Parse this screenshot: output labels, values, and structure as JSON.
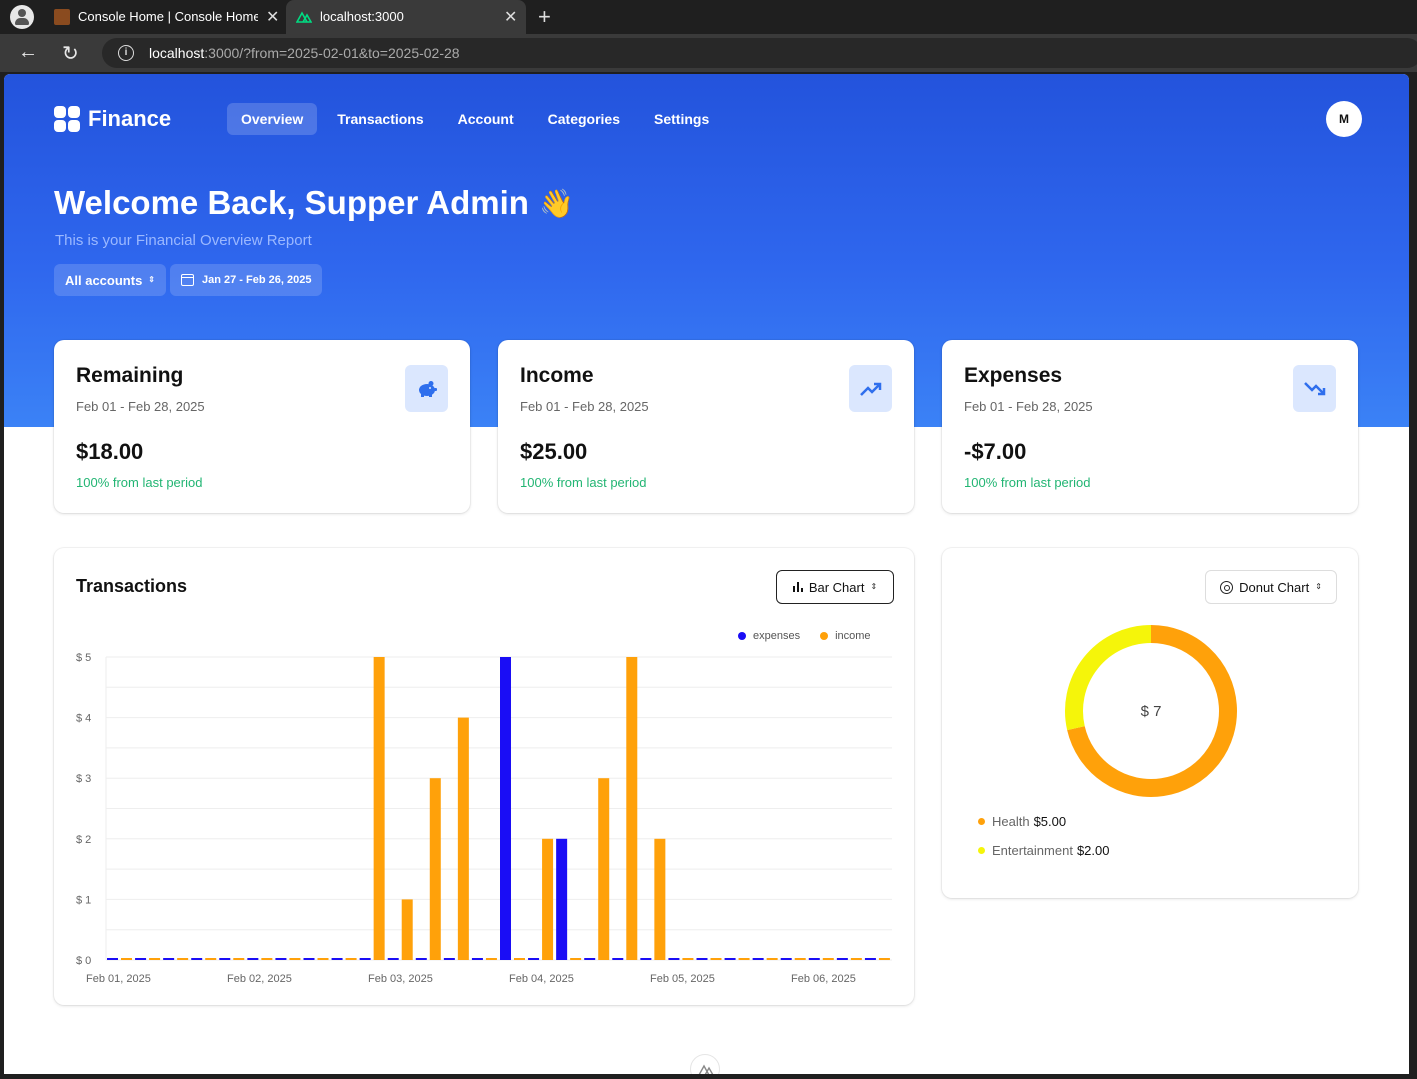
{
  "browser": {
    "tabs": [
      {
        "title": "Console Home | Console Home | c"
      },
      {
        "title": "localhost:3000"
      }
    ],
    "url_host": "localhost",
    "url_rest": ":3000/?from=2025-02-01&to=2025-02-28"
  },
  "header": {
    "logo": "Finance",
    "nav": [
      "Overview",
      "Transactions",
      "Account",
      "Categories",
      "Settings"
    ],
    "avatar": "M"
  },
  "hero": {
    "welcome": "Welcome Back, Supper Admin",
    "wave": "👋",
    "subtitle": "This is your Financial Overview Report",
    "account_filter": "All accounts",
    "date_filter": "Jan 27 - Feb 26, 2025"
  },
  "stats": [
    {
      "label": "Remaining",
      "period": "Feb 01 - Feb 28, 2025",
      "amount": "$18.00",
      "change": "100% from last period",
      "icon": "piggy-bank-icon"
    },
    {
      "label": "Income",
      "period": "Feb 01 - Feb 28, 2025",
      "amount": "$25.00",
      "change": "100% from last period",
      "icon": "trending-up-icon"
    },
    {
      "label": "Expenses",
      "period": "Feb 01 - Feb 28, 2025",
      "amount": "-$7.00",
      "change": "100% from last period",
      "icon": "trending-down-icon"
    }
  ],
  "colors": {
    "accent": "#2f67ee",
    "expenses": "#1a0df5",
    "income": "#ffa10a",
    "entertainment": "#f5f50a",
    "positive": "#22b573"
  },
  "transactions": {
    "title": "Transactions",
    "chart_select": "Bar Chart"
  },
  "donut": {
    "chart_select": "Donut Chart",
    "center": "$ 7",
    "items": [
      {
        "name": "Health",
        "value": "$5.00"
      },
      {
        "name": "Entertainment",
        "value": "$2.00"
      }
    ]
  },
  "chart_data": [
    {
      "type": "bar",
      "title": "Transactions",
      "series": [
        {
          "name": "expenses",
          "values": [
            0,
            0,
            0,
            0,
            0,
            0,
            0,
            0,
            0,
            0,
            0,
            0,
            0,
            0,
            5,
            0,
            2,
            0,
            0,
            0,
            0,
            0,
            0,
            0,
            0,
            0,
            0,
            0
          ]
        },
        {
          "name": "income",
          "values": [
            0,
            0,
            0,
            0,
            0,
            0,
            0,
            0,
            0,
            5,
            1,
            3,
            4,
            0,
            0,
            2,
            0,
            3,
            5,
            2,
            0,
            0,
            0,
            0,
            0,
            0,
            0,
            0
          ]
        }
      ],
      "x_tick_labels": [
        "Feb 01, 2025",
        "Feb 02, 2025",
        "Feb 03, 2025",
        "Feb 04, 2025",
        "Feb 05, 2025",
        "Feb 06, 2025"
      ],
      "y_tick_labels": [
        "$ 0",
        "$ 1",
        "$ 2",
        "$ 3",
        "$ 4",
        "$ 5"
      ],
      "ylim": [
        0,
        5
      ],
      "grid": true,
      "legend": "top-right"
    },
    {
      "type": "pie",
      "variant": "donut",
      "categories": [
        "Health",
        "Entertainment"
      ],
      "values": [
        5,
        2
      ],
      "center_label": "$ 7",
      "legend": "bottom-left"
    }
  ]
}
